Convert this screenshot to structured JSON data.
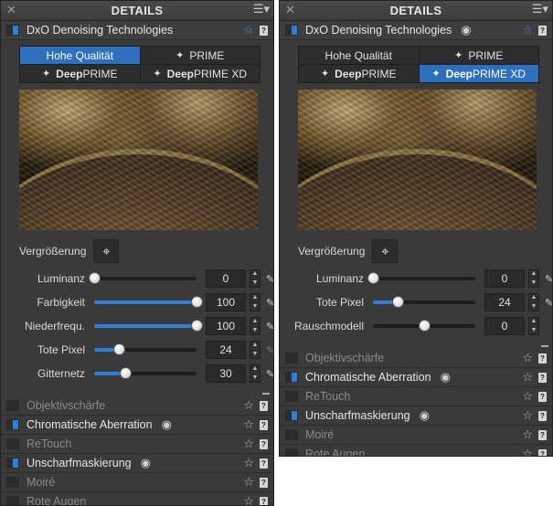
{
  "panels": [
    {
      "title": "DETAILS",
      "section_title": "DxO Denoising Technologies",
      "modes": [
        {
          "pre": "",
          "strong": "",
          "label": "Hohe Qualität",
          "spark": "",
          "active": true
        },
        {
          "pre": "",
          "strong": "",
          "label": "PRIME",
          "spark": "✦",
          "active": false
        },
        {
          "pre": "",
          "strong": "Deep",
          "label": "PRIME",
          "spark": "✦",
          "active": false
        },
        {
          "pre": "",
          "strong": "Deep",
          "label": "PRIME XD",
          "spark": "✦",
          "active": false
        }
      ],
      "zoom_label": "Vergrößerung",
      "sliders": [
        {
          "label": "Luminanz",
          "value": "0",
          "fraction": 0.0,
          "wand": true
        },
        {
          "label": "Farbigkeit",
          "value": "100",
          "fraction": 1.0,
          "wand": true
        },
        {
          "label": "Niederfrequ.",
          "value": "100",
          "fraction": 1.0,
          "wand": true
        },
        {
          "label": "Tote Pixel",
          "value": "24",
          "fraction": 0.24,
          "wand": true
        },
        {
          "label": "Gitternetz",
          "value": "30",
          "fraction": 0.3,
          "wand": true
        }
      ],
      "sections": [
        {
          "title": "Objektivschärfe",
          "on": false,
          "dim": true,
          "eye": false
        },
        {
          "title": "Chromatische Aberration",
          "on": true,
          "dim": false,
          "eye": true
        },
        {
          "title": "ReTouch",
          "on": false,
          "dim": true,
          "eye": false
        },
        {
          "title": "Unscharfmaskierung",
          "on": true,
          "dim": false,
          "eye": true
        },
        {
          "title": "Moiré",
          "on": false,
          "dim": true,
          "eye": false
        },
        {
          "title": "Rote Augen",
          "on": false,
          "dim": true,
          "eye": false
        }
      ]
    },
    {
      "title": "DETAILS",
      "section_title": "DxO Denoising Technologies",
      "modes": [
        {
          "pre": "",
          "strong": "",
          "label": "Hohe Qualität",
          "spark": "",
          "active": false
        },
        {
          "pre": "",
          "strong": "",
          "label": "PRIME",
          "spark": "✦",
          "active": false
        },
        {
          "pre": "",
          "strong": "Deep",
          "label": "PRIME",
          "spark": "✦",
          "active": false
        },
        {
          "pre": "",
          "strong": "Deep",
          "label": "PRIME XD",
          "spark": "✦",
          "active": true
        }
      ],
      "zoom_label": "Vergrößerung",
      "sliders": [
        {
          "label": "Luminanz",
          "value": "0",
          "fraction": 0.0,
          "wand": true
        },
        {
          "label": "Tote Pixel",
          "value": "24",
          "fraction": 0.24,
          "wand": true
        },
        {
          "label": "Rauschmodell",
          "value": "0",
          "fraction": 0.5,
          "wand": false
        }
      ],
      "sections": [
        {
          "title": "Objektivschärfe",
          "on": false,
          "dim": true,
          "eye": false
        },
        {
          "title": "Chromatische Aberration",
          "on": true,
          "dim": false,
          "eye": true
        },
        {
          "title": "ReTouch",
          "on": false,
          "dim": true,
          "eye": false
        },
        {
          "title": "Unscharfmaskierung",
          "on": true,
          "dim": false,
          "eye": true
        },
        {
          "title": "Moiré",
          "on": false,
          "dim": true,
          "eye": false
        },
        {
          "title": "Rote Augen",
          "on": false,
          "dim": true,
          "eye": false
        }
      ]
    }
  ],
  "icons": {
    "close": "✕",
    "menu": "☰▾",
    "star": "☆",
    "help": "?",
    "eye": "◉",
    "target": "⌖",
    "wand": "✎"
  },
  "colors": {
    "accent": "#2e6fbe",
    "panel_bg": "#3a3a3a"
  }
}
